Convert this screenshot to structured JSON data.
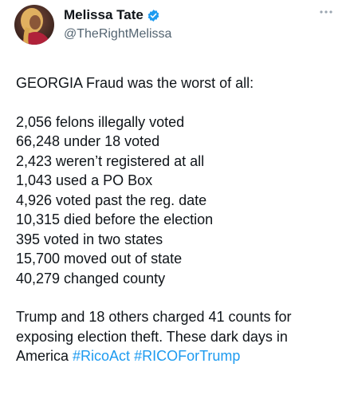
{
  "author": {
    "name": "Melissa Tate",
    "handle": "@TheRightMelissa",
    "verified": true,
    "accent_color": "#1d9bf0"
  },
  "tweet": {
    "headline": "GEORGIA Fraud was the worst of all:",
    "stats": [
      "2,056 felons illegally voted",
      "66,248 under 18 voted",
      "2,423 weren’t registered at all",
      "1,043 used a PO Box",
      "4,926 voted past the reg. date",
      "10,315 died before the election",
      "395 voted in two states",
      "15,700 moved out of state",
      "40,279 changed county"
    ],
    "closing_text": "Trump and 18 others charged 41 counts for exposing election theft. These dark days in America",
    "hashtags": [
      "#RicoAct",
      "#RICOForTrump"
    ]
  },
  "icons": {
    "verified": "verified-badge-icon",
    "more": "more-options-icon"
  }
}
